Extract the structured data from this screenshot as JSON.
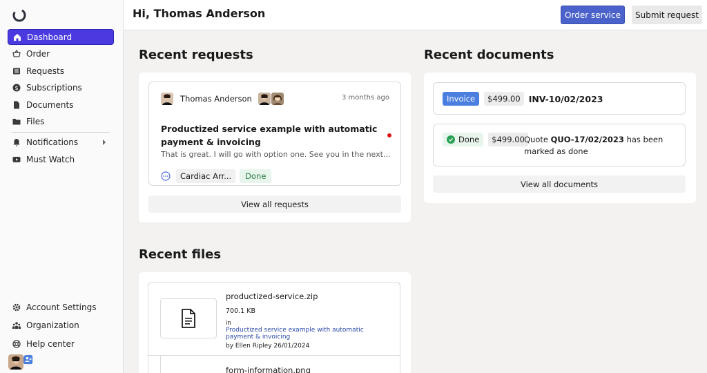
{
  "sidebar": {
    "nav": [
      {
        "label": "Dashboard",
        "icon": "home-icon"
      },
      {
        "label": "Order",
        "icon": "basket-icon"
      },
      {
        "label": "Requests",
        "icon": "list-icon"
      },
      {
        "label": "Subscriptions",
        "icon": "dollar-icon"
      },
      {
        "label": "Documents",
        "icon": "document-icon"
      },
      {
        "label": "Files",
        "icon": "folder-icon"
      },
      {
        "label": "Notifications",
        "icon": "bell-icon"
      },
      {
        "label": "Must Watch",
        "icon": "video-icon"
      }
    ],
    "bottom": [
      {
        "label": "Account Settings",
        "icon": "gear-icon"
      },
      {
        "label": "Organization",
        "icon": "people-icon"
      },
      {
        "label": "Help center",
        "icon": "lifebuoy-icon"
      }
    ]
  },
  "header": {
    "greeting": "Hi, Thomas Anderson",
    "order_service": "Order service",
    "submit_request": "Submit request"
  },
  "requests": {
    "title": "Recent requests",
    "item": {
      "user": "Thomas Anderson",
      "time": "3 months ago",
      "title": "Productized service example with automatic payment & invoicing",
      "snippet": "That is great. I will go with option one. See you in the next...",
      "service": "Cardiac Arr...",
      "status": "Done"
    },
    "view_all": "View all requests"
  },
  "documents": {
    "title": "Recent documents",
    "items": [
      {
        "badge": "Invoice",
        "price": "$499.00",
        "name": "INV-10/02/2023"
      },
      {
        "badge": "Done",
        "price": "$499.00",
        "text_before": "Quote",
        "code": "QUO-17/02/2023",
        "text_after": "has been",
        "text_line2": "marked as done"
      }
    ],
    "view_all": "View all documents"
  },
  "files": {
    "title": "Recent files",
    "items": [
      {
        "name": "productized-service.zip",
        "size": "700.1 KB",
        "in": "in",
        "link": "Productized service example with automatic payment & invoicing",
        "by": "by Ellen Ripley 26/01/2024"
      },
      {
        "name": "form-information.png"
      }
    ]
  },
  "colors": {
    "accent": "#4a3ae0",
    "primary_button": "#4a62c9",
    "done_green": "#2aa055",
    "invoice_blue": "#4a7fe0",
    "unread_dot": "#dd1111"
  }
}
